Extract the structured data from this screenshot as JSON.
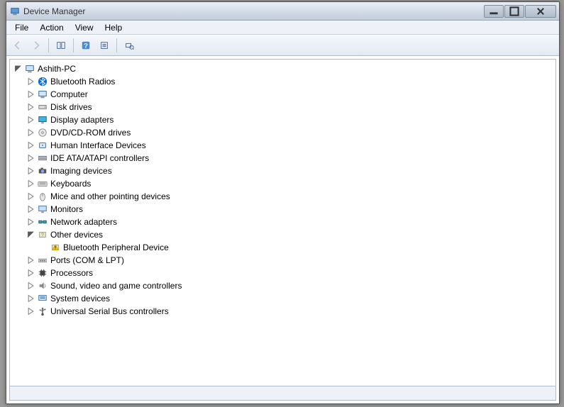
{
  "window": {
    "title": "Device Manager"
  },
  "menubar": [
    "File",
    "Action",
    "View",
    "Help"
  ],
  "toolbar": {
    "back": {
      "name": "back-button",
      "icon": "arrow-left",
      "disabled": true
    },
    "forward": {
      "name": "forward-button",
      "icon": "arrow-right",
      "disabled": true
    },
    "showhide": {
      "name": "show-hide-console-button",
      "icon": "console"
    },
    "help": {
      "name": "help-button",
      "icon": "help"
    },
    "properties": {
      "name": "properties-button",
      "icon": "properties"
    },
    "scan": {
      "name": "scan-hardware-button",
      "icon": "scan"
    }
  },
  "tree": {
    "root": {
      "label": "Ashith-PC",
      "icon": "computer"
    },
    "items": [
      {
        "label": "Bluetooth Radios",
        "icon": "bluetooth"
      },
      {
        "label": "Computer",
        "icon": "computer"
      },
      {
        "label": "Disk drives",
        "icon": "disk"
      },
      {
        "label": "Display adapters",
        "icon": "display"
      },
      {
        "label": "DVD/CD-ROM drives",
        "icon": "dvd"
      },
      {
        "label": "Human Interface Devices",
        "icon": "hid"
      },
      {
        "label": "IDE ATA/ATAPI controllers",
        "icon": "ide"
      },
      {
        "label": "Imaging devices",
        "icon": "imaging"
      },
      {
        "label": "Keyboards",
        "icon": "keyboard"
      },
      {
        "label": "Mice and other pointing devices",
        "icon": "mouse"
      },
      {
        "label": "Monitors",
        "icon": "monitor"
      },
      {
        "label": "Network adapters",
        "icon": "network"
      },
      {
        "label": "Other devices",
        "icon": "other",
        "expanded": true,
        "children": [
          {
            "label": "Bluetooth Peripheral Device",
            "icon": "warning"
          }
        ]
      },
      {
        "label": "Ports (COM & LPT)",
        "icon": "ports"
      },
      {
        "label": "Processors",
        "icon": "processor"
      },
      {
        "label": "Sound, video and game controllers",
        "icon": "sound"
      },
      {
        "label": "System devices",
        "icon": "system"
      },
      {
        "label": "Universal Serial Bus controllers",
        "icon": "usb"
      }
    ]
  }
}
